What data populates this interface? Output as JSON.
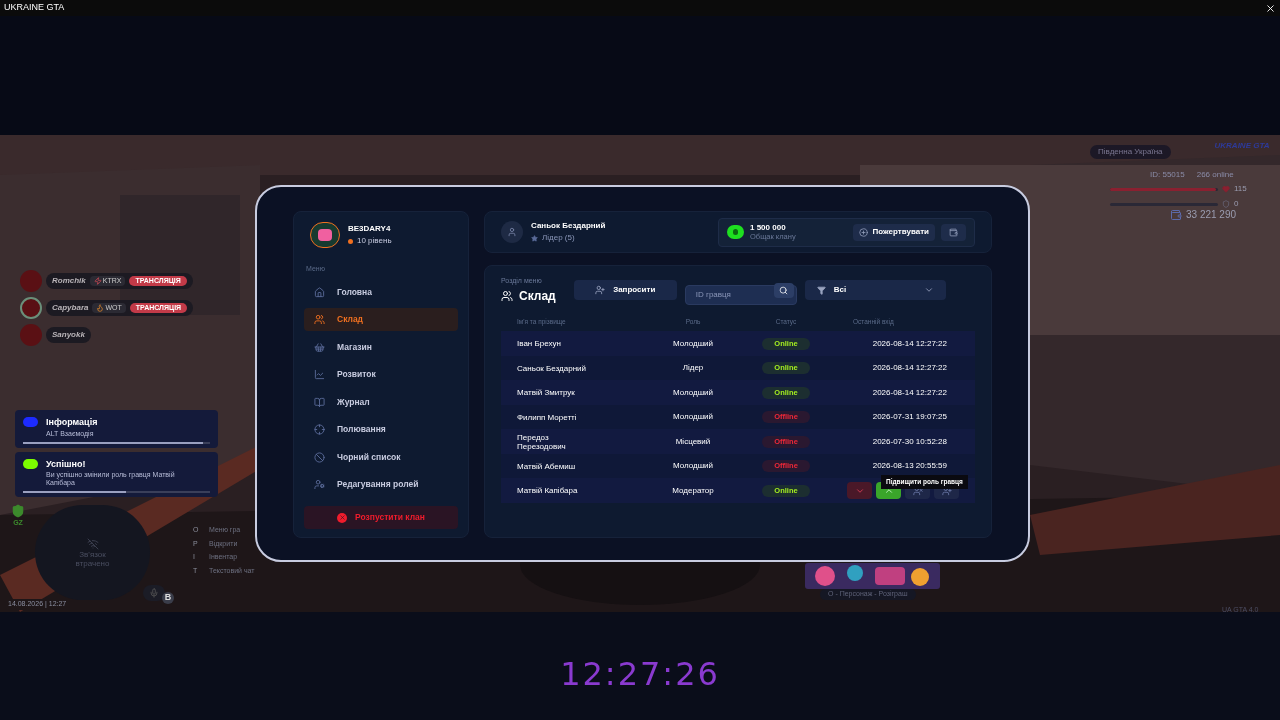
{
  "window": {
    "title": "UKRAINE GTA"
  },
  "hud": {
    "streamers": [
      {
        "name": "Romchik",
        "game": "KTRX",
        "kind": "bolt",
        "badge": "ТРАНСЛЯЦІЯ",
        "speaking": false
      },
      {
        "name": "Capybara",
        "game": "WOT",
        "kind": "fire",
        "badge": "ТРАНСЛЯЦІЯ",
        "speaking": true
      },
      {
        "name": "Sanyokk",
        "speaking": false
      }
    ],
    "notifications": [
      {
        "title": "Інформація",
        "text": "ALT Взаємодія",
        "color": "#1d2bff",
        "level": 0.96
      },
      {
        "title": "Успішно!",
        "text": "Ви успішно змінили роль гравця Матвій Капібара",
        "color": "#7cfc00",
        "level": 0.55
      }
    ],
    "zone": "GZ",
    "minimap": "Зв'язок втрачено",
    "voice_key": "B",
    "hotkeys": [
      {
        "key": "O",
        "label": "Меню гра"
      },
      {
        "key": "P",
        "label": "Відкрити"
      },
      {
        "key": "I",
        "label": "Інвентар"
      },
      {
        "key": "T",
        "label": "Текстовий чат"
      }
    ],
    "datetime": "14.08.2026 | 12:27",
    "server": "Південна Україна",
    "logo": "UKRAINE GTA",
    "player_id": "ID: 55015",
    "online": "266 online",
    "health": {
      "level": 0.98,
      "value": "115"
    },
    "armor": {
      "value": "0"
    },
    "money": "33 221 290",
    "promo": "O - Персонаж - Розіграш",
    "version": "UA GTA 4.0"
  },
  "tablet": {
    "profile": {
      "name": "BE3DARY4",
      "level": "10 рівень"
    },
    "menu_title": "Меню",
    "menu": [
      {
        "label": "Головна",
        "selected": false
      },
      {
        "label": "Склад",
        "selected": true
      },
      {
        "label": "Магазин",
        "selected": false
      },
      {
        "label": "Розвиток",
        "selected": false
      },
      {
        "label": "Журнал",
        "selected": false
      },
      {
        "label": "Полювання",
        "selected": false
      },
      {
        "label": "Чорний список",
        "selected": false
      },
      {
        "label": "Редагування ролей",
        "selected": false
      }
    ],
    "disband": "Розпустити клан",
    "member": {
      "name": "Саньок Бездарний",
      "role": "Лідер (5)"
    },
    "bank": {
      "amount": "1 500 000",
      "label": "Общак клану",
      "donate": "Пожертвувати"
    },
    "section_caption": "Розділ меню",
    "section": "Склад",
    "invite": "Запросити",
    "search": {
      "placeholder": "ID гравця"
    },
    "filter": "Всі",
    "table": {
      "columns": [
        "Ім'я та прізвище",
        "Роль",
        "Статус",
        "Останній вхід"
      ],
      "rows": [
        {
          "name": "Іван Брехун",
          "role": "Молодший",
          "status": "Online",
          "online": true,
          "last": "2026-08-14 12:27:22"
        },
        {
          "name": "Саньок Бездарний",
          "role": "Лідер",
          "status": "Online",
          "online": true,
          "last": "2026-08-14 12:27:22"
        },
        {
          "name": "Матвій Змитрук",
          "role": "Молодший",
          "status": "Online",
          "online": true,
          "last": "2026-08-14 12:27:22"
        },
        {
          "name": "Филипп Моретті",
          "role": "Молодший",
          "status": "Offline",
          "online": false,
          "last": "2026-07-31 19:07:25"
        },
        {
          "name": "Передоз Перезодович",
          "role": "Місцевий",
          "status": "Offline",
          "online": false,
          "last": "2026-07-30 10:52:28"
        },
        {
          "name": "Матвій Абемиш",
          "role": "Молодший",
          "status": "Offline",
          "online": false,
          "last": "2026-08-13 20:55:59"
        },
        {
          "name": "Матвій Капібара",
          "role": "Модератор",
          "status": "Online",
          "online": true,
          "actions": [
            {
              "kind": "demote"
            },
            {
              "kind": "promote"
            },
            {
              "kind": "kick"
            },
            {
              "kind": "add"
            }
          ],
          "tooltip": "Підвищити роль гравця"
        }
      ]
    }
  },
  "clock": "12:27:26"
}
